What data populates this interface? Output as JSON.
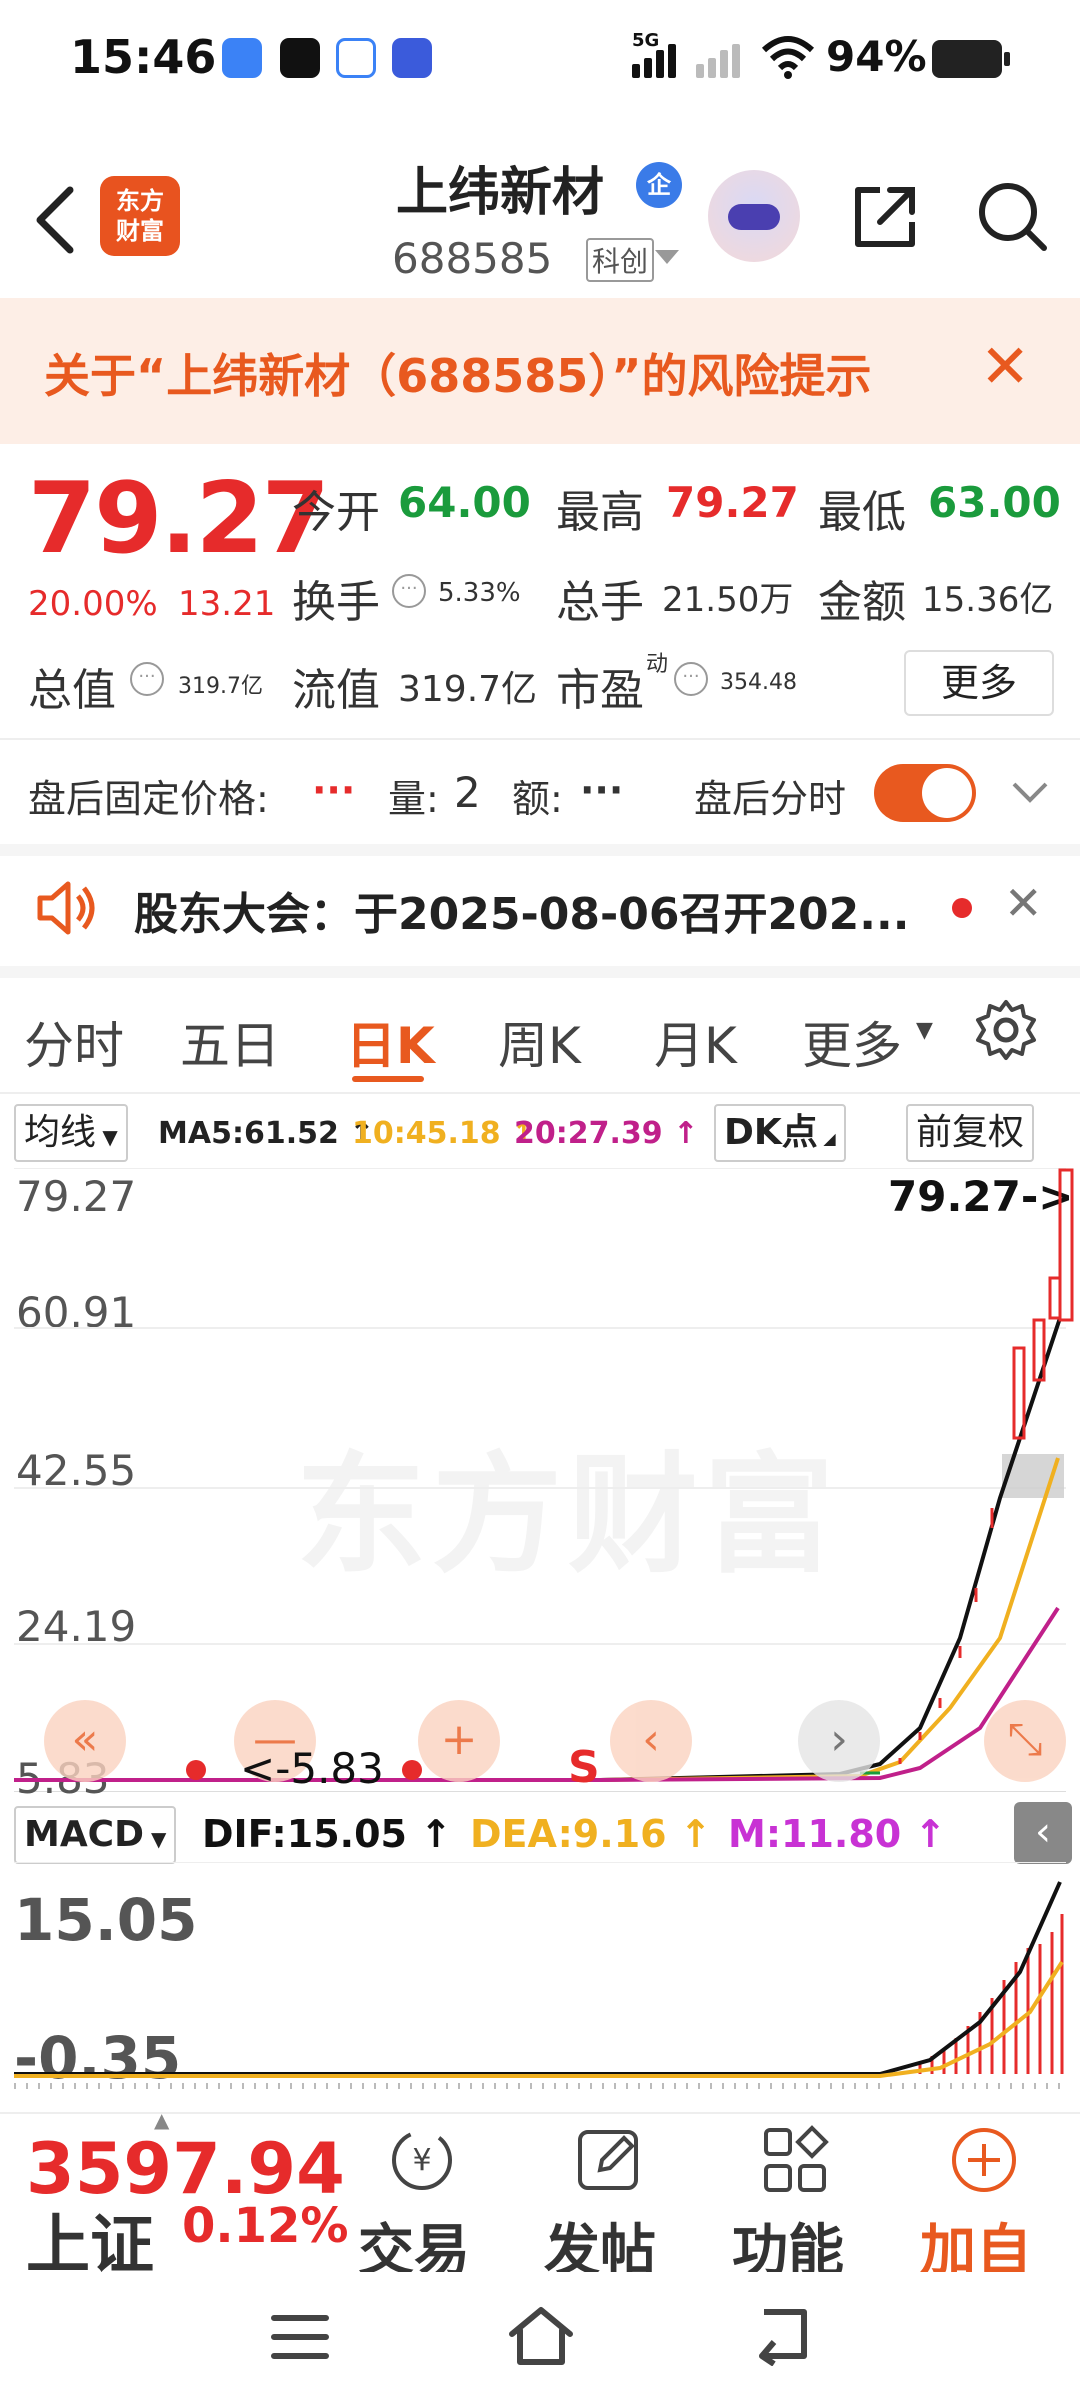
{
  "status_bar": {
    "time": "15:46",
    "network": "5G",
    "battery": "94%"
  },
  "header": {
    "title": "上纬新材",
    "code": "688585",
    "board": "科创",
    "verified_badge": "企",
    "logo_line1": "东方",
    "logo_line2": "财富"
  },
  "risk_banner": {
    "text": "关于“上纬新材（688585）”的风险提示"
  },
  "quote": {
    "price": "79.27",
    "change_pct": "20.00%",
    "change": "13.21",
    "open_label": "今开",
    "open": "64.00",
    "high_label": "最高",
    "high": "79.27",
    "low_label": "最低",
    "low": "63.00",
    "turnover_label": "换手",
    "turnover": "5.33%",
    "volume_label": "总手",
    "volume": "21.50万",
    "amount_label": "金额",
    "amount": "15.36亿",
    "mktcap_label": "总值",
    "mktcap": "319.7亿",
    "float_label": "流值",
    "float": "319.7亿",
    "pe_label": "市盈",
    "pe_sup": "动",
    "pe": "354.48",
    "more_btn": "更多"
  },
  "after_hours": {
    "price_label": "盘后固定价格:",
    "price_value": "···",
    "vol_label": "量:",
    "vol_value": "2",
    "amt_label": "额:",
    "amt_value": "···",
    "timeshare_label": "盘后分时"
  },
  "notice": {
    "text": "股东大会：于2025-08-06召开202..."
  },
  "tabs": [
    "分时",
    "五日",
    "日K",
    "周K",
    "月K",
    "更多"
  ],
  "chart_header": {
    "indicator": "均线",
    "ma5": "MA5:61.52 ↑",
    "ma10": "10:45.18 ↑",
    "ma20": "20:27.39 ↑",
    "dk": "DK点",
    "adjust": "前复权"
  },
  "chart_labels": {
    "y1": "79.27",
    "y2": "60.91",
    "y3": "42.55",
    "y4": "24.19",
    "y5": "5.83",
    "high_marker": "79.27->",
    "low_marker": "<-5.83",
    "s_marker": "S",
    "watermark": "东方财富"
  },
  "macd_header": {
    "name": "MACD",
    "dif": "DIF:15.05 ↑",
    "dea": "DEA:9.16 ↑",
    "m": "M:11.80 ↑",
    "y_top": "15.05",
    "y_bottom": "-0.35"
  },
  "bottom_nav": {
    "index_value": "3597.94",
    "index_name": "上证",
    "index_change": "0.12%",
    "trade": "交易",
    "post": "发帖",
    "function": "功能",
    "add": "加自"
  },
  "colors": {
    "accent": "#e8591f",
    "up": "#e62b2b",
    "down": "#1a9b3c",
    "ma10": "#f0b020",
    "ma20": "#c0208a"
  }
}
